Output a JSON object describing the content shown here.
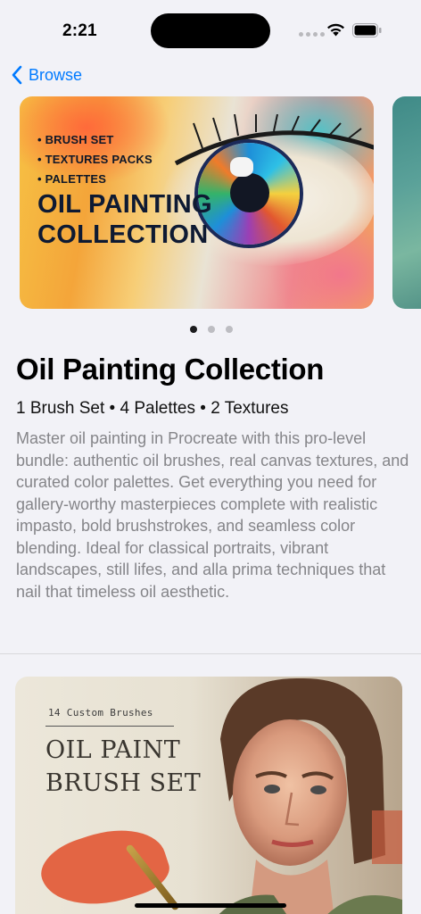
{
  "status_bar": {
    "time": "2:21"
  },
  "nav": {
    "back_label": "Browse"
  },
  "carousel": {
    "hero": {
      "bullets": [
        "• BRUSH SET",
        "• TEXTURES PACKS",
        "• PALETTES"
      ],
      "title": "OIL PAINTING COLLECTION"
    },
    "page_count": 3,
    "active_page": 1
  },
  "product": {
    "title": "Oil Painting Collection",
    "meta": "1 Brush Set • 4 Palettes • 2 Textures",
    "description": "Master oil painting in Procreate with this pro-level bundle: authentic  oil brushes, real canvas textures, and curated color palettes. Get everything you need for gallery-worthy masterpieces complete with  realistic impasto, bold brushstrokes, and seamless color blending. Ideal for classical portraits, vibrant landscapes, still lifes, and alla prima techniques that nail that timeless oil aesthetic."
  },
  "item_card": {
    "subtitle": "14 Custom Brushes",
    "title": "OIL PAINT BRUSH SET"
  },
  "colors": {
    "accent": "#007aff",
    "background": "#f2f2f7",
    "secondary_text": "#858589"
  }
}
